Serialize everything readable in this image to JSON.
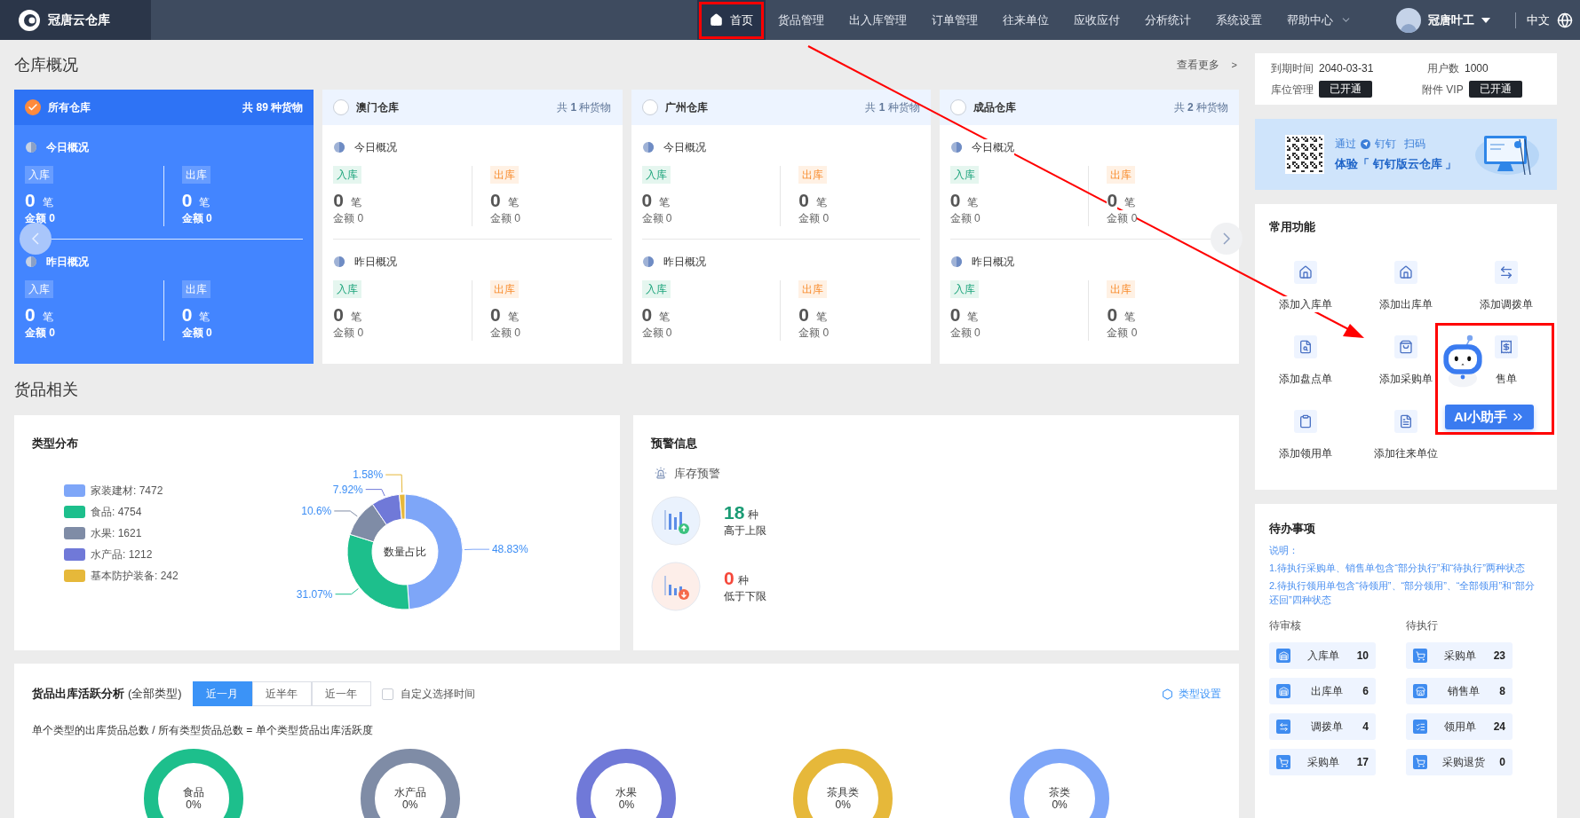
{
  "nav": {
    "logo": "冠唐云仓库",
    "items": [
      {
        "label": "首页",
        "kind": "home",
        "selected": true
      },
      {
        "label": "货品管理",
        "kind": "link",
        "selected": false
      },
      {
        "label": "出入库管理",
        "kind": "link",
        "selected": false
      },
      {
        "label": "订单管理",
        "kind": "link",
        "selected": false
      },
      {
        "label": "往来单位",
        "kind": "link",
        "selected": false
      },
      {
        "label": "应收应付",
        "kind": "link",
        "selected": false
      },
      {
        "label": "分析统计",
        "kind": "link",
        "selected": false
      },
      {
        "label": "系统设置",
        "kind": "link",
        "selected": false
      },
      {
        "label": "帮助中心",
        "kind": "menu",
        "selected": false
      }
    ],
    "user": {
      "name": "冠唐叶工"
    },
    "language": "中文"
  },
  "warehouse_overview": {
    "title": "仓库概况",
    "more": "查看更多",
    "more_arrow": ">",
    "cards": [
      {
        "name": "所有仓库",
        "count": "共 **89** 种货物",
        "selected": true,
        "sections": [
          {
            "title": "今日概况",
            "stats": [
              {
                "kind": "in",
                "tag": "入库",
                "count": "0",
                "unit": "笔",
                "amount": "金额 0"
              },
              {
                "kind": "out",
                "tag": "出库",
                "count": "0",
                "unit": "笔",
                "amount": "金额 0"
              }
            ]
          },
          {
            "title": "昨日概况",
            "stats": [
              {
                "kind": "in",
                "tag": "入库",
                "count": "0",
                "unit": "笔",
                "amount": "金额 0"
              },
              {
                "kind": "out",
                "tag": "出库",
                "count": "0",
                "unit": "笔",
                "amount": "金额 0"
              }
            ]
          }
        ]
      },
      {
        "name": "澳门仓库",
        "count": "共 **1** 种货物",
        "selected": false,
        "sections": [
          {
            "title": "今日概况",
            "stats": [
              {
                "kind": "in",
                "tag": "入库",
                "count": "0",
                "unit": "笔",
                "amount": "金额 0"
              },
              {
                "kind": "out",
                "tag": "出库",
                "count": "0",
                "unit": "笔",
                "amount": "金额 0"
              }
            ]
          },
          {
            "title": "昨日概况",
            "stats": [
              {
                "kind": "in",
                "tag": "入库",
                "count": "0",
                "unit": "笔",
                "amount": "金额 0"
              },
              {
                "kind": "out",
                "tag": "出库",
                "count": "0",
                "unit": "笔",
                "amount": "金额 0"
              }
            ]
          }
        ]
      },
      {
        "name": "广州仓库",
        "count": "共 **1** 种货物",
        "selected": false,
        "sections": [
          {
            "title": "今日概况",
            "stats": [
              {
                "kind": "in",
                "tag": "入库",
                "count": "0",
                "unit": "笔",
                "amount": "金额 0"
              },
              {
                "kind": "out",
                "tag": "出库",
                "count": "0",
                "unit": "笔",
                "amount": "金额 0"
              }
            ]
          },
          {
            "title": "昨日概况",
            "stats": [
              {
                "kind": "in",
                "tag": "入库",
                "count": "0",
                "unit": "笔",
                "amount": "金额 0"
              },
              {
                "kind": "out",
                "tag": "出库",
                "count": "0",
                "unit": "笔",
                "amount": "金额 0"
              }
            ]
          }
        ]
      },
      {
        "name": "成品仓库",
        "count": "共 **2** 种货物",
        "selected": false,
        "sections": [
          {
            "title": "今日概况",
            "stats": [
              {
                "kind": "in",
                "tag": "入库",
                "count": "0",
                "unit": "笔",
                "amount": "金额 0"
              },
              {
                "kind": "out",
                "tag": "出库",
                "count": "0",
                "unit": "笔",
                "amount": "金额 0"
              }
            ]
          },
          {
            "title": "昨日概况",
            "stats": [
              {
                "kind": "in",
                "tag": "入库",
                "count": "0",
                "unit": "笔",
                "amount": "金额 0"
              },
              {
                "kind": "out",
                "tag": "出库",
                "count": "0",
                "unit": "笔",
                "amount": "金额 0"
              }
            ]
          }
        ]
      }
    ]
  },
  "goods": {
    "title": "货品相关",
    "type_distribution": {
      "title": "类型分布",
      "legend": [
        {
          "label": "家装建材: 7472",
          "color": "#7ea6f8"
        },
        {
          "label": "食品: 4754",
          "color": "#1dbf8c"
        },
        {
          "label": "水果: 1621",
          "color": "#7f8ca6"
        },
        {
          "label": "水产品: 1212",
          "color": "#7079d8"
        },
        {
          "label": "基本防护装备: 242",
          "color": "#e6b83a"
        }
      ],
      "chart_data": {
        "type": "donut",
        "title": "数量占比",
        "values": [
          48.83,
          31.07,
          10.6,
          7.92,
          1.58
        ],
        "value_labels": [
          "48.83%",
          "31.07%",
          "10.6%",
          "7.92%",
          "1.58%"
        ]
      }
    },
    "warning": {
      "title": "预警信息",
      "subtitle": "库存预警",
      "items": [
        {
          "kind": "high",
          "count": "18",
          "unit": "种",
          "label": "高于上限"
        },
        {
          "kind": "low",
          "count": "0",
          "unit": "种",
          "label": "低于下限"
        }
      ]
    }
  },
  "activity": {
    "title": "货品出库活跃分析",
    "scope": "(全部类型)",
    "ranges": [
      {
        "label": "近一月",
        "selected": true
      },
      {
        "label": "近半年",
        "selected": false
      },
      {
        "label": "近一年",
        "selected": false
      }
    ],
    "custom": {
      "label": "自定义选择时间",
      "checked": false
    },
    "settings": "类型设置",
    "formula": "单个类型的出库货品总数 / 所有类型货品总数 = 单个类型货品出库活跃度",
    "rings": [
      {
        "name": "食品",
        "value": "0%",
        "color": "#1dbf8c"
      },
      {
        "name": "水产品",
        "value": "0%",
        "color": "#7f8ca6"
      },
      {
        "name": "水果",
        "value": "0%",
        "color": "#7079d8"
      },
      {
        "name": "茶具类",
        "value": "0%",
        "color": "#e6b83a"
      },
      {
        "name": "茶类",
        "value": "0%",
        "color": "#7ea6f8"
      }
    ]
  },
  "account": {
    "rows": [
      {
        "label": "到期时间",
        "value": "2040-03-31"
      },
      {
        "label": "用户数",
        "value": "1000"
      }
    ],
    "badges": [
      {
        "label": "库位管理",
        "status": "已开通"
      },
      {
        "label": "附件 VIP",
        "status": "已开通"
      }
    ]
  },
  "banner": {
    "prefix": "通过",
    "brand": "钉钉",
    "suffix": "扫码",
    "headline": "体验「 钉钉版云仓库 」"
  },
  "functions": {
    "title": "常用功能",
    "items": [
      {
        "label": "添加入库单",
        "kind": "in"
      },
      {
        "label": "添加出库单",
        "kind": "out"
      },
      {
        "label": "添加调拨单",
        "kind": "transfer"
      },
      {
        "label": "添加盘点单",
        "kind": "stocktake"
      },
      {
        "label": "添加采购单",
        "kind": "purchase"
      },
      {
        "label": "售单",
        "kind": "sale"
      },
      {
        "label": "添加领用单",
        "kind": "requisition"
      },
      {
        "label": "添加往来单位",
        "kind": "partner"
      }
    ]
  },
  "ai_assistant": {
    "label": "AI小助手"
  },
  "todo": {
    "title": "待办事项",
    "note_title": "说明：",
    "notes": [
      "1.待执行采购单、销售单包含“部分执行”和“待执行”两种状态",
      "2.待执行领用单包含“待领用”、“部分领用”、“全部领用”和“部分还回”四种状态"
    ],
    "columns": [
      {
        "title": "待审核",
        "items": [
          {
            "label": "入库单",
            "count": "10",
            "kind": "in"
          },
          {
            "label": "出库单",
            "count": "6",
            "kind": "out"
          },
          {
            "label": "调拨单",
            "count": "4",
            "kind": "transfer"
          },
          {
            "label": "采购单",
            "count": "17",
            "kind": "purchase"
          }
        ]
      },
      {
        "title": "待执行",
        "items": [
          {
            "label": "采购单",
            "count": "23",
            "kind": "purchase"
          },
          {
            "label": "销售单",
            "count": "8",
            "kind": "sale"
          },
          {
            "label": "领用单",
            "count": "24",
            "kind": "requisition"
          },
          {
            "label": "采购退货",
            "count": "0",
            "kind": "purchase"
          }
        ]
      }
    ]
  }
}
